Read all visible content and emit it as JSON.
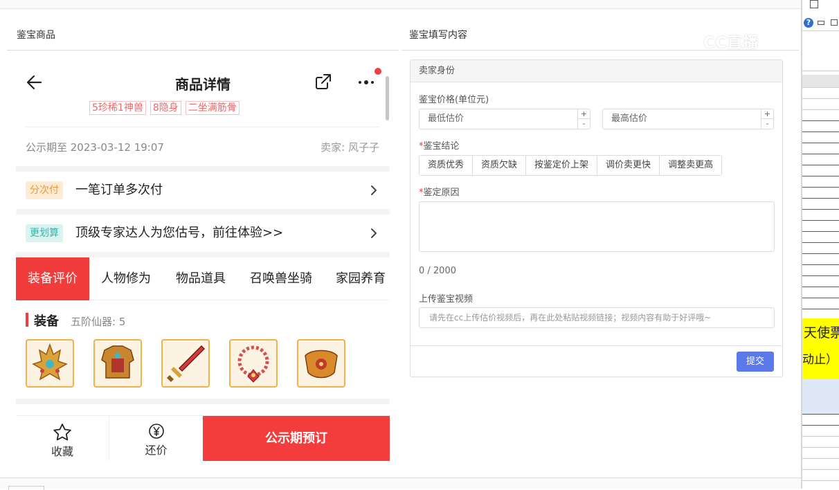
{
  "sections": {
    "left_title": "鉴宝商品",
    "right_title": "鉴宝填写内容"
  },
  "phone": {
    "title": "商品详情",
    "tags": [
      "5珍稀1神兽",
      "8隐身",
      "二坐满筋骨"
    ],
    "publish_time": "公示期至 2023-03-12 19:07",
    "seller": "卖家: 风子子",
    "installment": {
      "badge": "分次付",
      "text": "一笔订单多次付"
    },
    "valuation": {
      "badge": "更划算",
      "text": "顶级专家达人为您估号，前往体验>>"
    },
    "tabs": [
      "装备评价",
      "人物修为",
      "物品道具",
      "召唤兽坐骑",
      "家园养育"
    ],
    "equipment": {
      "title": "装备",
      "subtitle": "五阶仙器: 5",
      "items": [
        "crown-icon",
        "armor-icon",
        "sword-icon",
        "necklace-icon",
        "belt-icon"
      ]
    },
    "bottom": {
      "favorite": "收藏",
      "bargain": "还价",
      "reserve": "公示期预订"
    }
  },
  "form": {
    "header": "卖家身份",
    "price_label": "鉴宝价格(单位元)",
    "min_placeholder": "最低估价",
    "max_placeholder": "最高估价",
    "conclusion_label": "鉴宝结论",
    "conclusion_options": [
      "资质优秀",
      "资质欠缺",
      "按鉴定价上架",
      "调价卖更快",
      "调整卖更高"
    ],
    "reason_label": "鉴定原因",
    "counter": "0 / 2000",
    "video_label": "上传鉴宝视频",
    "video_placeholder": "请先在cc上传估价视频后，再在此处粘贴视频链接；视频内容有助于好评哦~",
    "submit": "提交"
  },
  "right_panel": {
    "text1": "天使票",
    "text2": "动止）"
  },
  "watermark": "CC直播",
  "colors": {
    "accent_red": "#f13c3c",
    "submit_blue": "#5b79e8",
    "highlight_yellow": "#ffff00"
  }
}
